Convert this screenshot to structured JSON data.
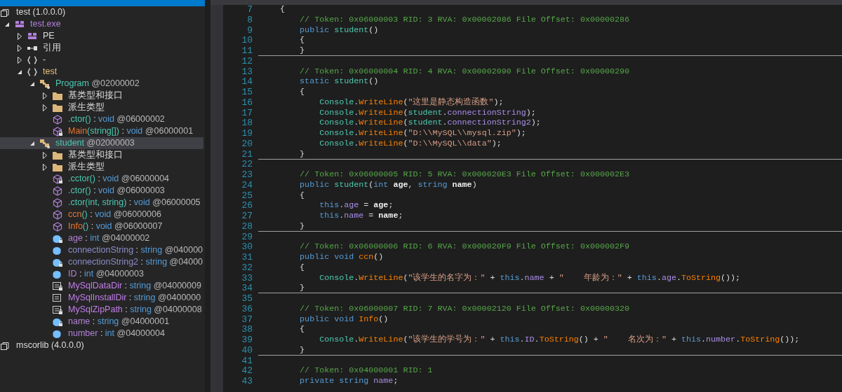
{
  "explorer": {
    "tree": [
      {
        "kind": "assembly",
        "name": "test (1.0.0.0)",
        "selected": false,
        "children": [
          {
            "kind": "module",
            "name": "test.exe",
            "expanded": true,
            "selected": false,
            "children": [
              {
                "kind": "pe",
                "name": "PE",
                "expanded": false,
                "selected": false
              },
              {
                "kind": "reference",
                "name": "引用",
                "expanded": false,
                "selected": false
              },
              {
                "kind": "empty-namespace",
                "name": "-",
                "expanded": false,
                "selected": false
              },
              {
                "kind": "namespace",
                "name": "test",
                "expanded": true,
                "selected": false,
                "children": [
                  {
                    "kind": "class",
                    "name": "Program",
                    "token": "@02000002",
                    "expanded": true,
                    "selected": false,
                    "children": [
                      {
                        "kind": "folder",
                        "name": "基类型和接口",
                        "expanded": false,
                        "selected": false
                      },
                      {
                        "kind": "folder",
                        "name": "派生类型",
                        "expanded": false,
                        "selected": false
                      },
                      {
                        "kind": "ctor",
                        "name": ".ctor",
                        "params": "()",
                        "colon": ":",
                        "type": "void",
                        "token": "@06000002",
                        "private": false,
                        "selected": false
                      },
                      {
                        "kind": "method",
                        "name": "Main",
                        "params": "(string[])",
                        "colon": ":",
                        "type": "void",
                        "token": "@06000001",
                        "private": true,
                        "selected": false
                      }
                    ]
                  },
                  {
                    "kind": "class",
                    "name": "student",
                    "token": "@02000003",
                    "expanded": true,
                    "selected": true,
                    "children": [
                      {
                        "kind": "folder",
                        "name": "基类型和接口",
                        "expanded": false,
                        "selected": false
                      },
                      {
                        "kind": "folder",
                        "name": "派生类型",
                        "expanded": false,
                        "selected": false
                      },
                      {
                        "kind": "ctor",
                        "name": ".cctor",
                        "params": "()",
                        "colon": ":",
                        "type": "void",
                        "token": "@06000004",
                        "private": true,
                        "selected": false
                      },
                      {
                        "kind": "ctor",
                        "name": ".ctor",
                        "params": "()",
                        "colon": ":",
                        "type": "void",
                        "token": "@06000003",
                        "private": false,
                        "selected": false
                      },
                      {
                        "kind": "ctor",
                        "name": ".ctor",
                        "params": "(int, string)",
                        "colon": ":",
                        "type": "void",
                        "token": "@06000005",
                        "private": false,
                        "selected": false
                      },
                      {
                        "kind": "method",
                        "name": "ccn",
                        "params": "()",
                        "colon": ":",
                        "type": "void",
                        "token": "@06000006",
                        "private": false,
                        "selected": false
                      },
                      {
                        "kind": "method",
                        "name": "Info",
                        "params": "()",
                        "colon": ":",
                        "type": "void",
                        "token": "@06000007",
                        "private": false,
                        "selected": false
                      },
                      {
                        "kind": "field",
                        "name": "age",
                        "colon": ":",
                        "type": "int",
                        "token": "@04000002",
                        "private": true,
                        "selected": false
                      },
                      {
                        "kind": "static-field",
                        "name": "connectionString",
                        "colon": ":",
                        "type": "string",
                        "token": "@040000",
                        "private": false,
                        "selected": false
                      },
                      {
                        "kind": "static-field",
                        "name": "connectionString2",
                        "colon": ":",
                        "type": "string",
                        "token": "@04000",
                        "private": true,
                        "selected": false
                      },
                      {
                        "kind": "field",
                        "name": "ID",
                        "colon": ":",
                        "type": "int",
                        "token": "@04000003",
                        "private": false,
                        "selected": false
                      },
                      {
                        "kind": "constant",
                        "name": "MySqlDataDir",
                        "colon": ":",
                        "type": "string",
                        "token": "@04000009",
                        "private": true,
                        "selected": false
                      },
                      {
                        "kind": "constant",
                        "name": "MySqlInstallDir",
                        "colon": ":",
                        "type": "string",
                        "token": "@0400000",
                        "private": false,
                        "selected": false
                      },
                      {
                        "kind": "constant",
                        "name": "MySqlZipPath",
                        "colon": ":",
                        "type": "string",
                        "token": "@04000008",
                        "private": true,
                        "selected": false
                      },
                      {
                        "kind": "field",
                        "name": "name",
                        "colon": ":",
                        "type": "string",
                        "token": "@04000001",
                        "private": true,
                        "selected": false
                      },
                      {
                        "kind": "field",
                        "name": "number",
                        "colon": ":",
                        "type": "int",
                        "token": "@04000004",
                        "private": false,
                        "selected": false
                      }
                    ]
                  }
                ]
              }
            ]
          }
        ]
      },
      {
        "kind": "assembly",
        "name": "mscorlib (4.0.0.0)",
        "selected": false
      }
    ]
  },
  "editor": {
    "lines": [
      {
        "number": "7",
        "separator": false,
        "tokens": [
          {
            "kind": "plain",
            "text": "    {"
          }
        ]
      },
      {
        "number": "8",
        "separator": false,
        "tokens": [
          {
            "kind": "comment",
            "text": "        // Token: 0x06000003 RID: 3 RVA: 0x00002086 File Offset: 0x00000286"
          }
        ]
      },
      {
        "number": "9",
        "separator": false,
        "tokens": [
          {
            "kind": "keyword",
            "text": "        public"
          },
          {
            "kind": "type",
            "text": " student"
          },
          {
            "kind": "plain",
            "text": "()"
          }
        ]
      },
      {
        "number": "10",
        "separator": false,
        "tokens": [
          {
            "kind": "plain",
            "text": "        {"
          }
        ]
      },
      {
        "number": "11",
        "separator": true,
        "tokens": [
          {
            "kind": "plain",
            "text": "        }"
          }
        ]
      },
      {
        "number": "12",
        "separator": false
      },
      {
        "number": "13",
        "separator": false,
        "tokens": [
          {
            "kind": "comment",
            "text": "        // Token: 0x06000004 RID: 4 RVA: 0x00002090 File Offset: 0x00000290"
          }
        ]
      },
      {
        "number": "14",
        "separator": false,
        "tokens": [
          {
            "kind": "keyword",
            "text": "        static"
          },
          {
            "kind": "type",
            "text": " student"
          },
          {
            "kind": "plain",
            "text": "()"
          }
        ]
      },
      {
        "number": "15",
        "separator": false,
        "tokens": [
          {
            "kind": "plain",
            "text": "        {"
          }
        ]
      },
      {
        "number": "16",
        "separator": false,
        "tokens": [
          {
            "kind": "type",
            "text": "            Console"
          },
          {
            "kind": "plain",
            "text": "."
          },
          {
            "kind": "method",
            "text": "WriteLine"
          },
          {
            "kind": "plain",
            "text": "("
          },
          {
            "kind": "string",
            "text": "\"这里是静态构造函数\""
          },
          {
            "kind": "plain",
            "text": ");"
          }
        ]
      },
      {
        "number": "17",
        "separator": false,
        "tokens": [
          {
            "kind": "type",
            "text": "            Console"
          },
          {
            "kind": "plain",
            "text": "."
          },
          {
            "kind": "method",
            "text": "WriteLine"
          },
          {
            "kind": "plain",
            "text": "("
          },
          {
            "kind": "type",
            "text": "student"
          },
          {
            "kind": "plain",
            "text": "."
          },
          {
            "kind": "field",
            "text": "connectionString"
          },
          {
            "kind": "plain",
            "text": ");"
          }
        ]
      },
      {
        "number": "18",
        "separator": false,
        "tokens": [
          {
            "kind": "type",
            "text": "            Console"
          },
          {
            "kind": "plain",
            "text": "."
          },
          {
            "kind": "method",
            "text": "WriteLine"
          },
          {
            "kind": "plain",
            "text": "("
          },
          {
            "kind": "type",
            "text": "student"
          },
          {
            "kind": "plain",
            "text": "."
          },
          {
            "kind": "field",
            "text": "connectionString2"
          },
          {
            "kind": "plain",
            "text": ");"
          }
        ]
      },
      {
        "number": "19",
        "separator": false,
        "tokens": [
          {
            "kind": "type",
            "text": "            Console"
          },
          {
            "kind": "plain",
            "text": "."
          },
          {
            "kind": "method",
            "text": "WriteLine"
          },
          {
            "kind": "plain",
            "text": "("
          },
          {
            "kind": "string",
            "text": "\"D:\\\\MySQL\\\\mysql.zip\""
          },
          {
            "kind": "plain",
            "text": ");"
          }
        ]
      },
      {
        "number": "20",
        "separator": false,
        "tokens": [
          {
            "kind": "type",
            "text": "            Console"
          },
          {
            "kind": "plain",
            "text": "."
          },
          {
            "kind": "method",
            "text": "WriteLine"
          },
          {
            "kind": "plain",
            "text": "("
          },
          {
            "kind": "string",
            "text": "\"D:\\\\MySQL\\\\data\""
          },
          {
            "kind": "plain",
            "text": ");"
          }
        ]
      },
      {
        "number": "21",
        "separator": true,
        "tokens": [
          {
            "kind": "plain",
            "text": "        }"
          }
        ]
      },
      {
        "number": "22",
        "separator": false
      },
      {
        "number": "23",
        "separator": false,
        "tokens": [
          {
            "kind": "comment",
            "text": "        // Token: 0x06000005 RID: 5 RVA: 0x000020E3 File Offset: 0x000002E3"
          }
        ]
      },
      {
        "number": "24",
        "separator": false,
        "tokens": [
          {
            "kind": "keyword",
            "text": "        public"
          },
          {
            "kind": "type",
            "text": " student"
          },
          {
            "kind": "plain",
            "text": "("
          },
          {
            "kind": "keyword",
            "text": "int"
          },
          {
            "kind": "param",
            "text": " age"
          },
          {
            "kind": "plain",
            "text": ", "
          },
          {
            "kind": "keyword",
            "text": "string"
          },
          {
            "kind": "param",
            "text": " name"
          },
          {
            "kind": "plain",
            "text": ")"
          }
        ]
      },
      {
        "number": "25",
        "separator": false,
        "tokens": [
          {
            "kind": "plain",
            "text": "        {"
          }
        ]
      },
      {
        "number": "26",
        "separator": false,
        "tokens": [
          {
            "kind": "keyword",
            "text": "            this"
          },
          {
            "kind": "plain",
            "text": "."
          },
          {
            "kind": "field",
            "text": "age"
          },
          {
            "kind": "plain",
            "text": " = "
          },
          {
            "kind": "param",
            "text": "age"
          },
          {
            "kind": "plain",
            "text": ";"
          }
        ]
      },
      {
        "number": "27",
        "separator": false,
        "tokens": [
          {
            "kind": "keyword",
            "text": "            this"
          },
          {
            "kind": "plain",
            "text": "."
          },
          {
            "kind": "field",
            "text": "name"
          },
          {
            "kind": "plain",
            "text": " = "
          },
          {
            "kind": "param",
            "text": "name"
          },
          {
            "kind": "plain",
            "text": ";"
          }
        ]
      },
      {
        "number": "28",
        "separator": true,
        "tokens": [
          {
            "kind": "plain",
            "text": "        }"
          }
        ]
      },
      {
        "number": "29",
        "separator": false
      },
      {
        "number": "30",
        "separator": false,
        "tokens": [
          {
            "kind": "comment",
            "text": "        // Token: 0x06000006 RID: 6 RVA: 0x000020F9 File Offset: 0x000002F9"
          }
        ]
      },
      {
        "number": "31",
        "separator": false,
        "tokens": [
          {
            "kind": "keyword",
            "text": "        public void"
          },
          {
            "kind": "method",
            "text": " ccn"
          },
          {
            "kind": "plain",
            "text": "()"
          }
        ]
      },
      {
        "number": "32",
        "separator": false,
        "tokens": [
          {
            "kind": "plain",
            "text": "        {"
          }
        ]
      },
      {
        "number": "33",
        "separator": false,
        "tokens": [
          {
            "kind": "type",
            "text": "            Console"
          },
          {
            "kind": "plain",
            "text": "."
          },
          {
            "kind": "method",
            "text": "WriteLine"
          },
          {
            "kind": "plain",
            "text": "("
          },
          {
            "kind": "string",
            "text": "\"该学生的名字为：\""
          },
          {
            "kind": "plain",
            "text": " + "
          },
          {
            "kind": "keyword",
            "text": "this"
          },
          {
            "kind": "plain",
            "text": "."
          },
          {
            "kind": "field",
            "text": "name"
          },
          {
            "kind": "plain",
            "text": " + "
          },
          {
            "kind": "string",
            "text": "\"    年龄为：\""
          },
          {
            "kind": "plain",
            "text": " + "
          },
          {
            "kind": "keyword",
            "text": "this"
          },
          {
            "kind": "plain",
            "text": "."
          },
          {
            "kind": "field",
            "text": "age"
          },
          {
            "kind": "plain",
            "text": "."
          },
          {
            "kind": "method",
            "text": "ToString"
          },
          {
            "kind": "plain",
            "text": "());"
          }
        ]
      },
      {
        "number": "34",
        "separator": true,
        "tokens": [
          {
            "kind": "plain",
            "text": "        }"
          }
        ]
      },
      {
        "number": "35",
        "separator": false
      },
      {
        "number": "36",
        "separator": false,
        "tokens": [
          {
            "kind": "comment",
            "text": "        // Token: 0x06000007 RID: 7 RVA: 0x00002120 File Offset: 0x00000320"
          }
        ]
      },
      {
        "number": "37",
        "separator": false,
        "tokens": [
          {
            "kind": "keyword",
            "text": "        public void"
          },
          {
            "kind": "method",
            "text": " Info"
          },
          {
            "kind": "plain",
            "text": "()"
          }
        ]
      },
      {
        "number": "38",
        "separator": false,
        "tokens": [
          {
            "kind": "plain",
            "text": "        {"
          }
        ]
      },
      {
        "number": "39",
        "separator": false,
        "tokens": [
          {
            "kind": "type",
            "text": "            Console"
          },
          {
            "kind": "plain",
            "text": "."
          },
          {
            "kind": "method",
            "text": "WriteLine"
          },
          {
            "kind": "plain",
            "text": "("
          },
          {
            "kind": "string",
            "text": "\"该学生的学号为：\""
          },
          {
            "kind": "plain",
            "text": " + "
          },
          {
            "kind": "keyword",
            "text": "this"
          },
          {
            "kind": "plain",
            "text": "."
          },
          {
            "kind": "field",
            "text": "ID"
          },
          {
            "kind": "plain",
            "text": "."
          },
          {
            "kind": "method",
            "text": "ToString"
          },
          {
            "kind": "plain",
            "text": "() + "
          },
          {
            "kind": "string",
            "text": "\"    名次为：\""
          },
          {
            "kind": "plain",
            "text": " + "
          },
          {
            "kind": "keyword",
            "text": "this"
          },
          {
            "kind": "plain",
            "text": "."
          },
          {
            "kind": "field",
            "text": "number"
          },
          {
            "kind": "plain",
            "text": "."
          },
          {
            "kind": "method",
            "text": "ToString"
          },
          {
            "kind": "plain",
            "text": "());"
          }
        ]
      },
      {
        "number": "40",
        "separator": true,
        "tokens": [
          {
            "kind": "plain",
            "text": "        }"
          }
        ]
      },
      {
        "number": "41",
        "separator": false
      },
      {
        "number": "42",
        "separator": false,
        "tokens": [
          {
            "kind": "comment",
            "text": "        // Token: 0x04000001 RID: 1"
          }
        ]
      },
      {
        "number": "43",
        "separator": false,
        "tokens": [
          {
            "kind": "keyword",
            "text": "        private string"
          },
          {
            "kind": "field",
            "text": " name"
          },
          {
            "kind": "plain",
            "text": ";"
          }
        ]
      }
    ]
  }
}
